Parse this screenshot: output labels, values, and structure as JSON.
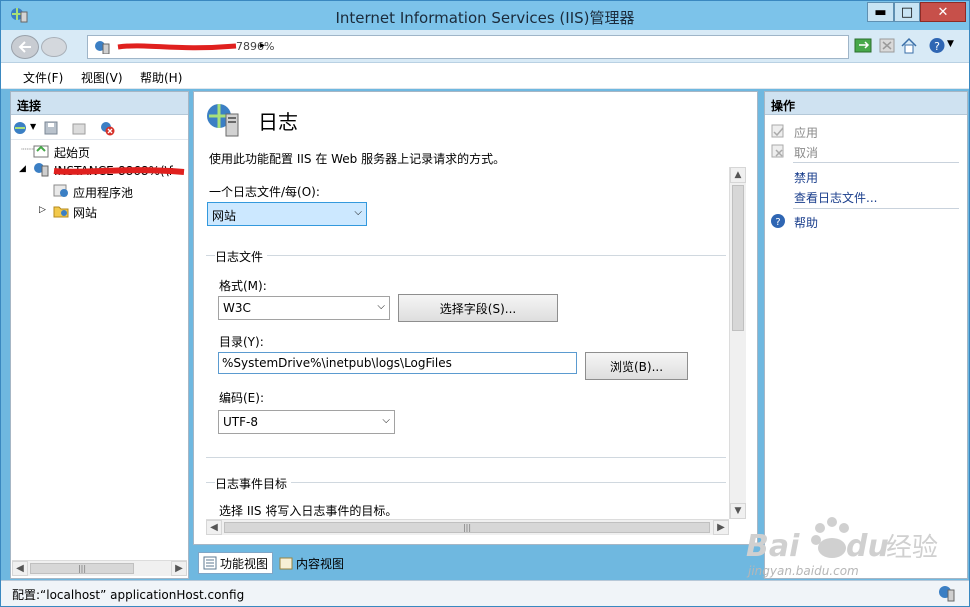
{
  "window": {
    "title": "Internet Information Services (IIS)管理器",
    "min_glyph": "▬",
    "max_glyph": "□",
    "close_glyph": "✕"
  },
  "address": {
    "crumb_suffix": "7896%",
    "separator": "▸"
  },
  "menu": [
    {
      "label": "文件(F)"
    },
    {
      "label": "视图(V)"
    },
    {
      "label": "帮助(H)"
    }
  ],
  "connections": {
    "title": "连接",
    "tree": [
      {
        "label": "起始页"
      },
      {
        "label": "INSTANCE-8868%(\\f"
      },
      {
        "label": "应用程序池"
      },
      {
        "label": "网站"
      }
    ],
    "expand_open": "◢",
    "expand_closed": "▷"
  },
  "main": {
    "title": "日志",
    "description": "使用此功能配置 IIS 在 Web 服务器上记录请求的方式。",
    "one_log_per_label": "一个日志文件/每(O):",
    "one_log_per_value": "网站",
    "log_file_group": "日志文件",
    "format_label": "格式(M):",
    "format_value": "W3C",
    "select_fields_button": "选择字段(S)...",
    "directory_label": "目录(Y):",
    "directory_value": "%SystemDrive%\\inetpub\\logs\\LogFiles",
    "browse_button": "浏览(B)...",
    "encoding_label": "编码(E):",
    "encoding_value": "UTF-8",
    "event_group": "日志事件目标",
    "event_desc": "选择 IIS 将写入日志事件的目标。"
  },
  "view_tabs": [
    {
      "label": "功能视图"
    },
    {
      "label": "内容视图"
    }
  ],
  "actions": {
    "title": "操作",
    "items": [
      {
        "label": "应用",
        "state": "disabled"
      },
      {
        "label": "取消",
        "state": "disabled"
      },
      {
        "label": "禁用",
        "state": "link"
      },
      {
        "label": "查看日志文件...",
        "state": "link"
      },
      {
        "label": "帮助",
        "state": "link"
      }
    ]
  },
  "status": {
    "text": "配置:“localhost” applicationHost.config"
  },
  "watermark": {
    "brand": "Bai du 经验",
    "domain": "jingyan.baidu.com"
  },
  "scroll": {
    "left": "◀",
    "right": "▶",
    "up": "▲",
    "down": "▼",
    "grip": "|||"
  },
  "colors": {
    "titlebar": "#7cc3ea",
    "accent": "#3399dd",
    "link": "#1a3e8c"
  }
}
